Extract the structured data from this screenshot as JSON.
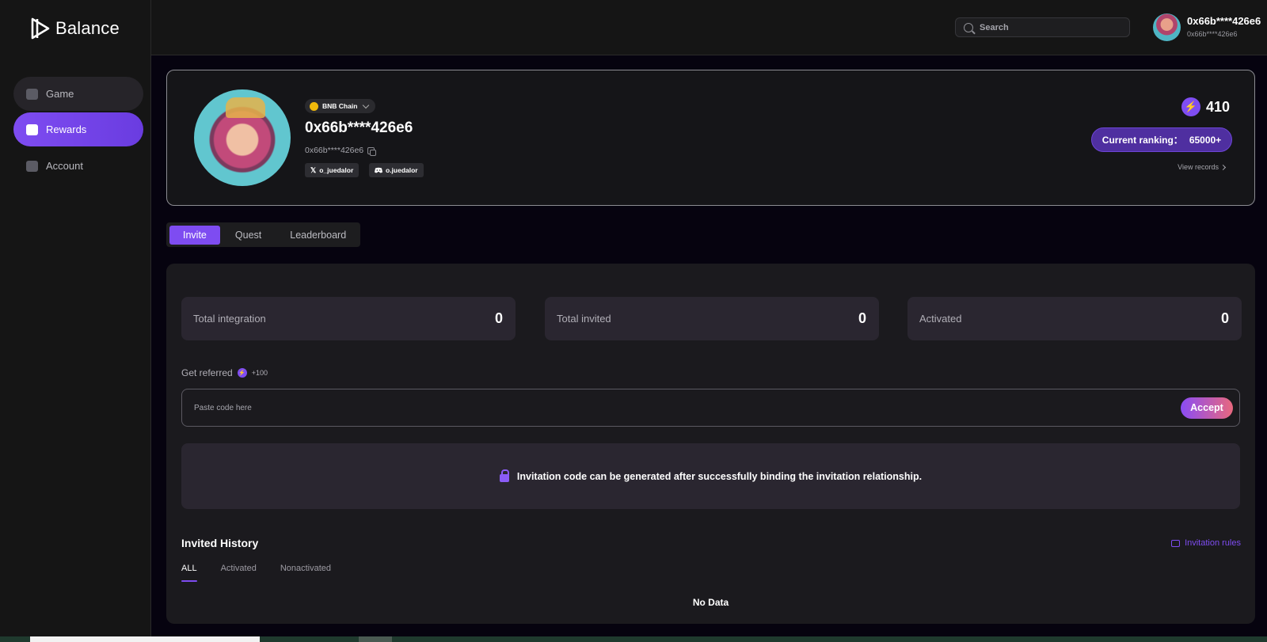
{
  "app": {
    "name": "Balance"
  },
  "sidebar": {
    "items": [
      {
        "label": "Game",
        "icon": "gamepad-icon"
      },
      {
        "label": "Rewards",
        "icon": "wallet-icon",
        "active": true
      },
      {
        "label": "Account",
        "icon": "chart-icon"
      }
    ]
  },
  "header": {
    "search_placeholder": "Search",
    "user_name": "0x66b****426e6",
    "user_sub": "0x66b****426e6"
  },
  "profile": {
    "chain": "BNB Chain",
    "address": "0x66b****426e6",
    "address_short": "0x66b****426e6",
    "twitter": "o_juedalor",
    "discord": "o.juedalor",
    "points": "410",
    "ranking_label": "Current ranking：",
    "ranking_value": "65000+",
    "view_records": "View records"
  },
  "tabs": [
    {
      "label": "Invite",
      "active": true
    },
    {
      "label": "Quest"
    },
    {
      "label": "Leaderboard"
    }
  ],
  "stats": [
    {
      "label": "Total integration",
      "value": "0"
    },
    {
      "label": "Total invited",
      "value": "0"
    },
    {
      "label": "Activated",
      "value": "0"
    }
  ],
  "referral": {
    "label": "Get referred",
    "bonus": "+100",
    "placeholder": "Paste code here",
    "accept_label": "Accept"
  },
  "notice": "Invitation code can be generated after successfully binding the invitation relationship.",
  "history": {
    "title": "Invited History",
    "rules_label": "Invitation rules",
    "filters": [
      "ALL",
      "Activated",
      "Nonactivated"
    ],
    "empty_text": "No Data"
  },
  "colors": {
    "accent": "#7e4cf1",
    "background": "#06030f",
    "panel": "#1b1a1e"
  }
}
